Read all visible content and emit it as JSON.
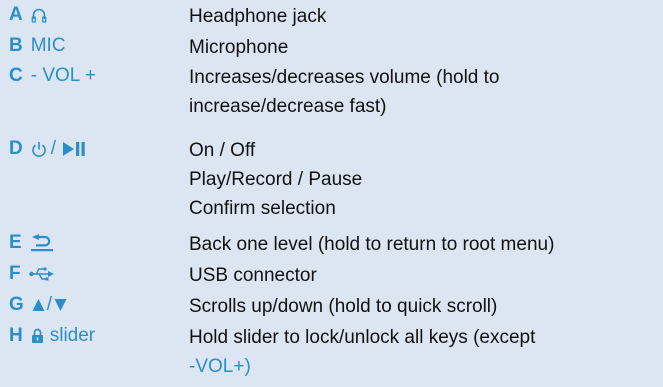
{
  "colors": {
    "accent": "#2a8fc8",
    "background": "#dce6f2",
    "text": "#111111"
  },
  "rows": [
    {
      "letter": "A",
      "icon": "headphone-icon",
      "label": "",
      "desc": [
        "Headphone jack"
      ]
    },
    {
      "letter": "B",
      "icon": "",
      "label": "MIC",
      "desc": [
        "Microphone"
      ]
    },
    {
      "letter": "C",
      "icon": "",
      "label": "- VOL +",
      "desc": [
        "Increases/decreases volume (hold to",
        "increase/decrease fast)"
      ]
    },
    {
      "letter": "D",
      "icon": "power-play-pause-icon",
      "label": "/",
      "desc": [
        "On / Off",
        "Play/Record / Pause",
        "Confirm selection"
      ]
    },
    {
      "letter": "E",
      "icon": "back-icon",
      "label": "",
      "desc": [
        "Back one level (hold to return to root menu)"
      ]
    },
    {
      "letter": "F",
      "icon": "usb-icon",
      "label": "",
      "desc": [
        "USB connector"
      ]
    },
    {
      "letter": "G",
      "icon": "up-down-icon",
      "label": "/",
      "desc": [
        "Scrolls up/down (hold to quick scroll)"
      ]
    },
    {
      "letter": "H",
      "icon": "lock-icon",
      "label": "slider",
      "desc": [
        "Hold slider to lock/unlock all keys (except"
      ],
      "desc_accent": "-VOL+)"
    }
  ]
}
